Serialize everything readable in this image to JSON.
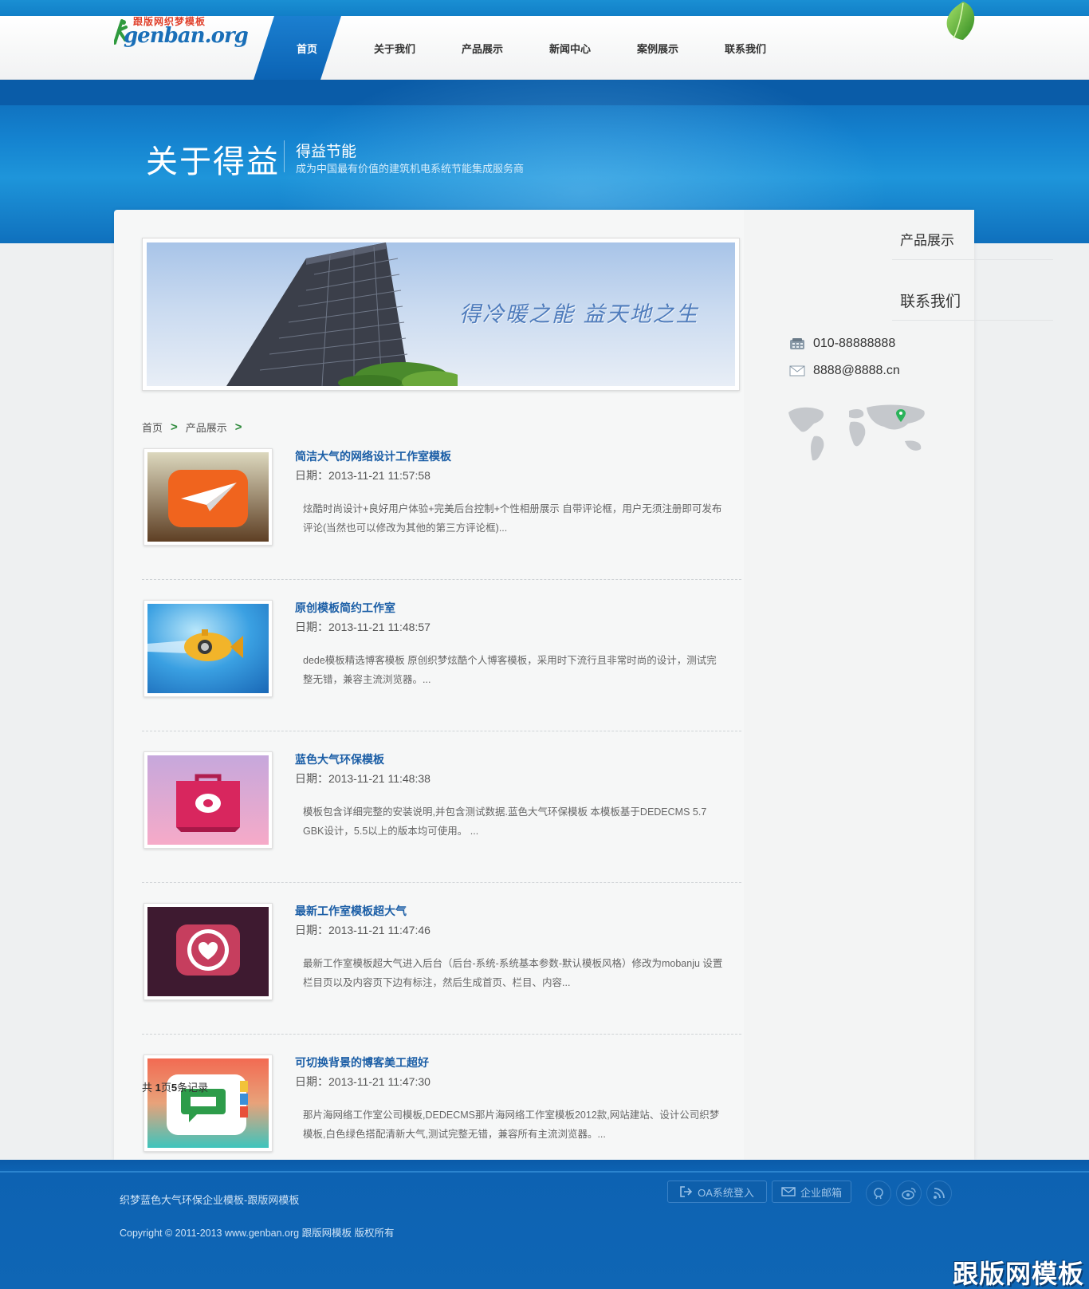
{
  "header": {
    "logo_cn": "跟版网织梦模板",
    "logo_en": "genban.org",
    "nav": [
      {
        "label": "首页",
        "active": true
      },
      {
        "label": "关于我们",
        "active": false
      },
      {
        "label": "产品展示",
        "active": false
      },
      {
        "label": "新闻中心",
        "active": false
      },
      {
        "label": "案例展示",
        "active": false
      },
      {
        "label": "联系我们",
        "active": false
      }
    ]
  },
  "banner": {
    "title": "关于得益",
    "subtitle": "得益节能",
    "tagline": "成为中国最有价值的建筑机电系统节能集成服务商"
  },
  "hero": {
    "slogan": "得冷暖之能  益天地之生"
  },
  "breadcrumb": {
    "home": "首页",
    "sep": ">",
    "section": "产品展示"
  },
  "articles": [
    {
      "title": "简洁大气的网络设计工作室模板",
      "date": "日期：2013-11-21 11:57:58",
      "desc": "炫酷时尚设计+良好用户体验+完美后台控制+个性相册展示 自带评论框，用户无须注册即可发布评论(当然也可以修改为其他的第三方评论框)...",
      "thumb_icon": "paper-plane-icon",
      "colors": [
        "#d6d2b8",
        "#6a4a2e",
        "#f0641e"
      ]
    },
    {
      "title": "原创模板简约工作室",
      "date": "日期：2013-11-21 11:48:57",
      "desc": "dede模板精选博客模板 原创织梦炫酷个人博客模板，采用时下流行且非常时尚的设计，测试完整无错，兼容主流浏览器。...",
      "thumb_icon": "submarine-icon",
      "colors": [
        "#2f8fd8",
        "#9fd8f6",
        "#f2c23a"
      ]
    },
    {
      "title": "蓝色大气环保模板",
      "date": "日期：2013-11-21 11:48:38",
      "desc": "模板包含详细完整的安装说明,并包含测试数据.蓝色大气环保模板 本模板基于DEDECMS 5.7 GBK设计，5.5以上的版本均可使用。 ...",
      "thumb_icon": "shopping-bag-icon",
      "colors": [
        "#c8a6d8",
        "#f3a8c4",
        "#d8265e"
      ]
    },
    {
      "title": "最新工作室模板超大气",
      "date": "日期：2013-11-21 11:47:46",
      "desc": "最新工作室模板超大气进入后台（后台-系统-系统基本参数-默认模板风格）修改为mobanju 设置栏目页以及内容页下边有标注，然后生成首页、栏目、内容...",
      "thumb_icon": "heart-badge-icon",
      "colors": [
        "#3e1a30",
        "#4a1c38",
        "#d14a6a"
      ]
    },
    {
      "title": "可切换背景的博客美工超好",
      "date": "日期：2013-11-21 11:47:30",
      "desc": "那片海网络工作室公司模板,DEDECMS那片海网络工作室模板2012款,网站建站、设计公司织梦模板,白色绿色搭配清新大气,测试完整无错，兼容所有主流浏览器。...",
      "thumb_icon": "chat-book-icon",
      "colors": [
        "#f06b55",
        "#44c4b8",
        "#2d9c4a"
      ]
    }
  ],
  "pagination": {
    "prefix": "共 ",
    "pages": "1",
    "mid": "页",
    "count": "5",
    "suffix": "条记录"
  },
  "sidebar": {
    "products_title": "产品展示",
    "contact_title": "联系我们",
    "phone": "010-88888888",
    "email": "8888@8888.cn"
  },
  "footer": {
    "title": "织梦蓝色大气环保企业模板-跟版网模板",
    "copyright": "Copyright © 2011-2013 www.genban.org 跟版网模板 版权所有",
    "oa_label": "OA系统登入",
    "mail_label": "企业邮箱"
  },
  "watermark": "跟版网模板",
  "colors": {
    "brand_blue": "#0f66b5",
    "link_blue": "#1b5ea6",
    "breadcrumb_green": "#2f8a3c"
  }
}
